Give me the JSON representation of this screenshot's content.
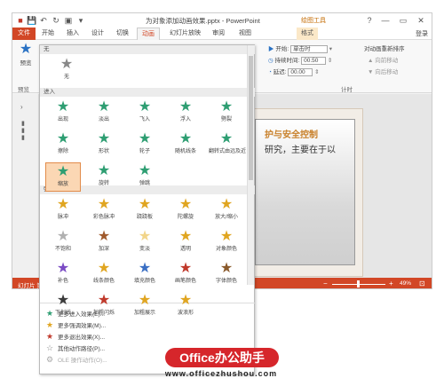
{
  "window": {
    "doc_title": "为对象添加动画效果.pptx - PowerPoint",
    "context_tab_title": "绘图工具",
    "help": "?",
    "login": "登录",
    "controls": [
      "—",
      "▭",
      "✕"
    ]
  },
  "tabs": [
    "文件",
    "开始",
    "插入",
    "设计",
    "切换",
    "动画",
    "幻灯片放映",
    "审阅",
    "视图",
    "格式"
  ],
  "ribbon": {
    "preview_label": "预览",
    "preview_group": "预览",
    "start_label": "开始:",
    "start_value": "单击时",
    "duration_label": "持续时间:",
    "duration_value": "00.50",
    "delay_label": "延迟:",
    "delay_value": "00.00",
    "reorder_title": "对动画重新排序",
    "move_earlier": "向前移动",
    "move_later": "向后移动",
    "timing_group": "计时"
  },
  "gallery": {
    "sections": {
      "none": "无",
      "enter": "进入",
      "emphasis": "强调"
    },
    "none_item": {
      "label": "无",
      "color": "#888888"
    },
    "enter_items": [
      {
        "label": "出现",
        "color": "#2e9e72"
      },
      {
        "label": "淡出",
        "color": "#2e9e72"
      },
      {
        "label": "飞入",
        "color": "#2e9e72"
      },
      {
        "label": "浮入",
        "color": "#2e9e72"
      },
      {
        "label": "劈裂",
        "color": "#2e9e72"
      },
      {
        "label": "擦除",
        "color": "#2e9e72"
      },
      {
        "label": "形状",
        "color": "#2e9e72"
      },
      {
        "label": "轮子",
        "color": "#2e9e72"
      },
      {
        "label": "随机线条",
        "color": "#2e9e72"
      },
      {
        "label": "翻转式由远及近",
        "color": "#2e9e72"
      },
      {
        "label": "缩放",
        "color": "#2e9e72",
        "selected": true
      },
      {
        "label": "旋转",
        "color": "#2e9e72"
      },
      {
        "label": "弹跳",
        "color": "#2e9e72"
      }
    ],
    "emphasis_items": [
      {
        "label": "脉冲",
        "color": "#e0a520"
      },
      {
        "label": "彩色脉冲",
        "color": "#e0a520"
      },
      {
        "label": "跷跷板",
        "color": "#e0a520"
      },
      {
        "label": "陀螺旋",
        "color": "#e0a520"
      },
      {
        "label": "放大/缩小",
        "color": "#e0a520"
      },
      {
        "label": "不饱和",
        "color": "#b0b0b0"
      },
      {
        "label": "加深",
        "color": "#a05a2c"
      },
      {
        "label": "变淡",
        "color": "#f2d58a"
      },
      {
        "label": "透明",
        "color": "#e0a520"
      },
      {
        "label": "对象颜色",
        "color": "#e0a520"
      },
      {
        "label": "补色",
        "color": "#7a4bc4"
      },
      {
        "label": "线条颜色",
        "color": "#e0a520"
      },
      {
        "label": "填充颜色",
        "color": "#3a6fc4"
      },
      {
        "label": "画笔颜色",
        "color": "#c0392b"
      },
      {
        "label": "字体颜色",
        "color": "#8a5a2c"
      },
      {
        "label": "下划线",
        "color": "#3a3a3a"
      },
      {
        "label": "加粗闪烁",
        "color": "#c0392b"
      },
      {
        "label": "加粗展示",
        "color": "#e0a520"
      },
      {
        "label": "波浪形",
        "color": "#e0a520"
      }
    ],
    "more": [
      {
        "label": "更多进入效果(E)...",
        "color": "#2e9e72"
      },
      {
        "label": "更多强调效果(M)...",
        "color": "#e0a520"
      },
      {
        "label": "更多退出效果(X)...",
        "color": "#c0392b"
      },
      {
        "label": "其他动作路径(P)...",
        "color": "#888888"
      },
      {
        "label": "OLE 操作动作(O)...",
        "color": "#aaaaaa"
      }
    ]
  },
  "slide": {
    "title": "护与安全控制",
    "text": "研究，主要在于以"
  },
  "status": {
    "left": "幻灯片 第",
    "zoom": "49%"
  },
  "watermark": {
    "top": "Office办公助手",
    "bottom": "www.officezhushou.com"
  }
}
